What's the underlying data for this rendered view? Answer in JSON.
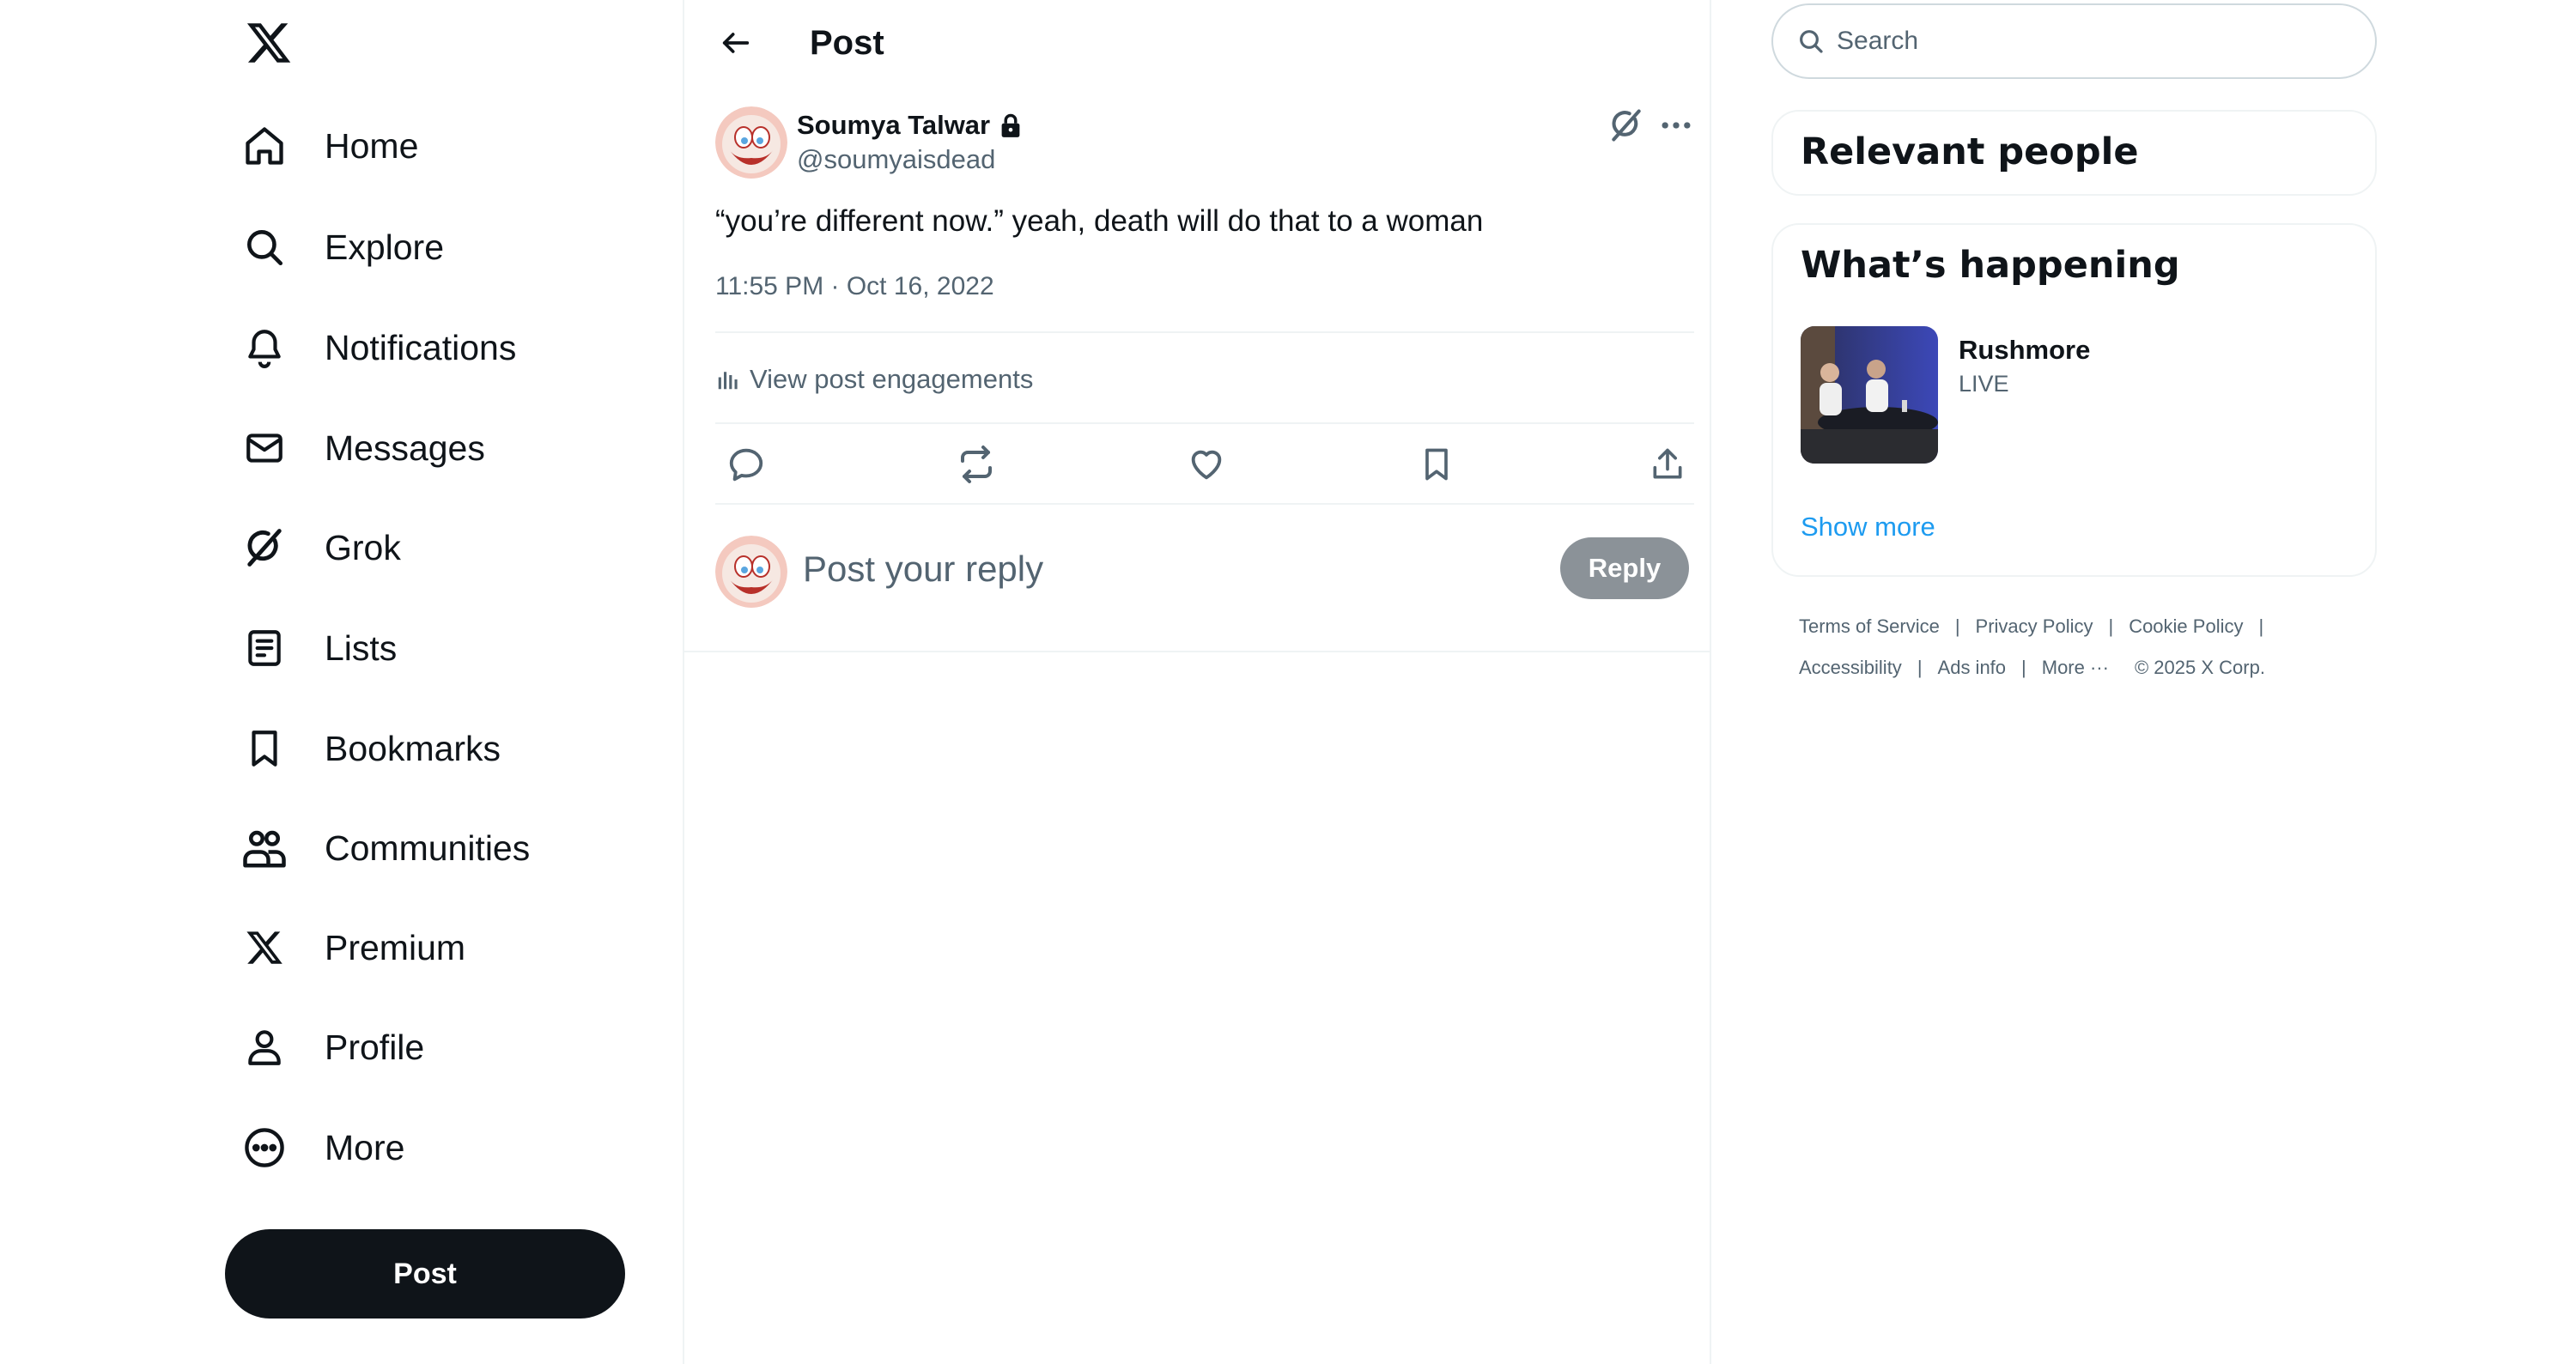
{
  "nav": {
    "items": [
      {
        "label": "Home",
        "icon": "home-icon"
      },
      {
        "label": "Explore",
        "icon": "search-icon"
      },
      {
        "label": "Notifications",
        "icon": "bell-icon"
      },
      {
        "label": "Messages",
        "icon": "envelope-icon"
      },
      {
        "label": "Grok",
        "icon": "grok-icon"
      },
      {
        "label": "Lists",
        "icon": "list-icon"
      },
      {
        "label": "Bookmarks",
        "icon": "bookmark-icon"
      },
      {
        "label": "Communities",
        "icon": "people-icon"
      },
      {
        "label": "Premium",
        "icon": "x-logo-icon"
      },
      {
        "label": "Profile",
        "icon": "person-icon"
      },
      {
        "label": "More",
        "icon": "more-circle-icon"
      }
    ],
    "post_button": "Post"
  },
  "header": {
    "title": "Post"
  },
  "post": {
    "author_name": "Soumya Talwar",
    "author_handle": "@soumyaisdead",
    "text": "“you’re different now.” yeah, death will do that to a woman",
    "timestamp": "11:55 PM · Oct 16, 2022",
    "engagements_label": "View post engagements"
  },
  "reply": {
    "placeholder": "Post your reply",
    "button": "Reply"
  },
  "sidebar": {
    "search_placeholder": "Search",
    "relevant_title": "Relevant people",
    "happening_title": "What’s happening",
    "trend": {
      "title": "Rushmore",
      "subtitle": "LIVE"
    },
    "show_more": "Show more",
    "footer": {
      "links_row1": [
        "Terms of Service",
        "Privacy Policy",
        "Cookie Policy"
      ],
      "links_row2": [
        "Accessibility",
        "Ads info",
        "More ···"
      ],
      "copyright": "© 2025 X Corp."
    }
  },
  "colors": {
    "text_primary": "#0f1419",
    "text_secondary": "#536471",
    "accent": "#1d9bf0",
    "border": "#eff3f4",
    "reply_button_disabled": "#8b9298"
  }
}
